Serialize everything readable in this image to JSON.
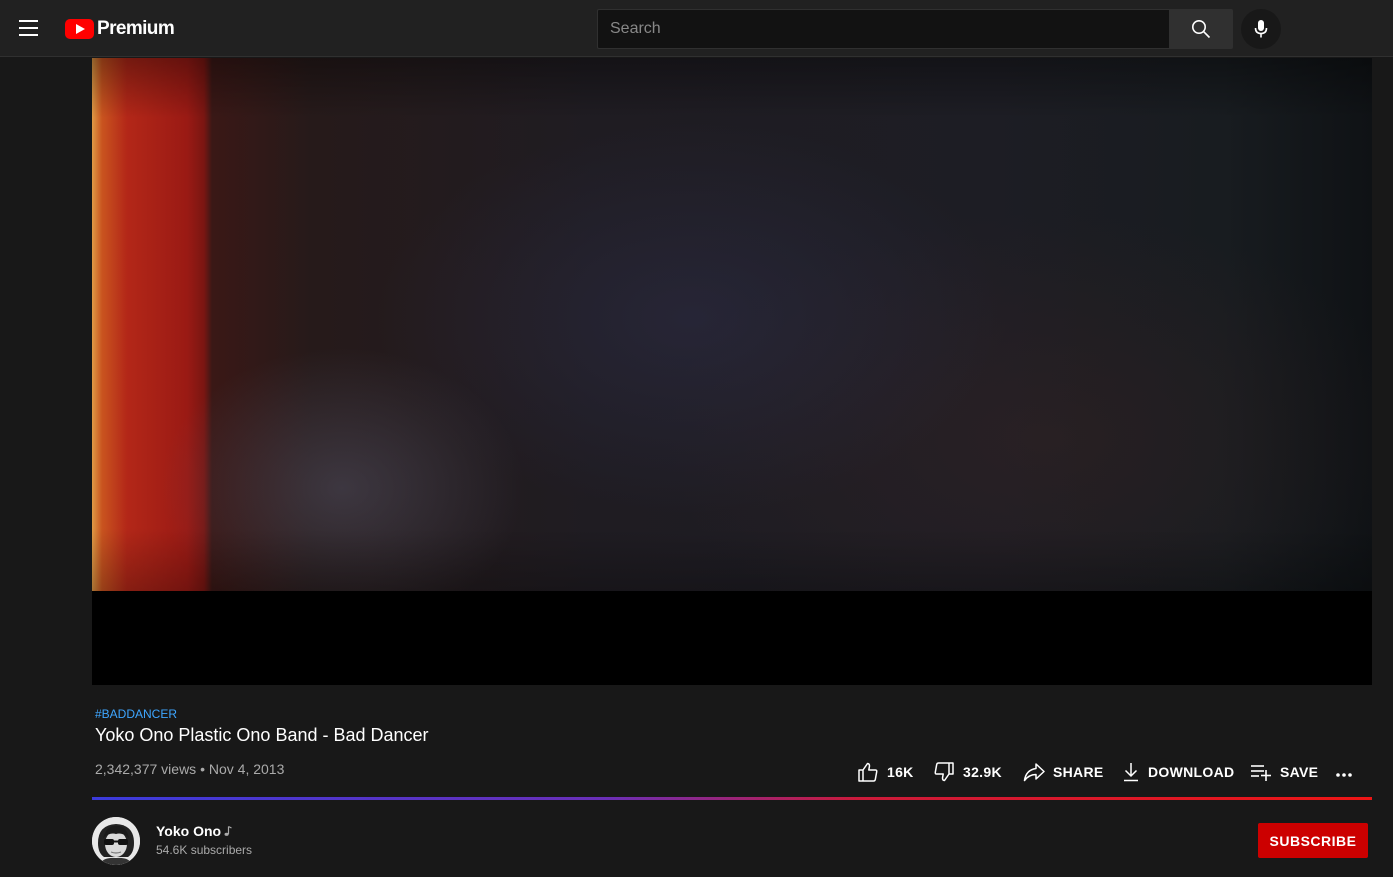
{
  "header": {
    "logo_text": "Premium",
    "search": {
      "placeholder": "Search",
      "value": ""
    }
  },
  "video": {
    "hashtag": "#BADDANCER",
    "title": "Yoko Ono Plastic Ono Band - Bad Dancer",
    "views": "2,342,377 views",
    "separator": "•",
    "date": "Nov 4, 2013"
  },
  "actions": {
    "like_count": "16K",
    "dislike_count": "32.9K",
    "share_label": "SHARE",
    "download_label": "DOWNLOAD",
    "save_label": "SAVE"
  },
  "channel": {
    "name": "Yoko Ono",
    "subscribers": "54.6K subscribers",
    "subscribe_label": "SUBSCRIBE"
  },
  "colors": {
    "brand_red": "#ff0000",
    "subscribe_red": "#cc0000",
    "link_blue": "#3ea6ff",
    "background": "#181818",
    "masthead": "#212121"
  },
  "icons": [
    "menu-icon",
    "youtube-logo-icon",
    "search-icon",
    "mic-icon",
    "like-icon",
    "dislike-icon",
    "share-icon",
    "download-icon",
    "save-playlist-icon",
    "more-icon",
    "music-note-icon"
  ]
}
